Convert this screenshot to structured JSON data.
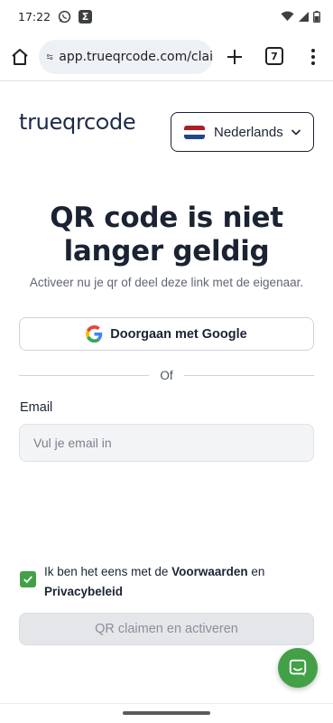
{
  "status_bar": {
    "time": "17:22",
    "icons": [
      "whatsapp-icon",
      "sigma-icon",
      "wifi-icon",
      "signal-icon",
      "battery-icon"
    ]
  },
  "browser": {
    "url": "app.trueqrcode.com/clai",
    "tab_count": "7"
  },
  "header": {
    "logo_text_before": "trueqrc",
    "logo_text_after": "de",
    "language": {
      "selected": "Nederlands",
      "flag_colors": [
        "#ae1c28",
        "#ffffff",
        "#21468b"
      ]
    }
  },
  "main": {
    "title_line1": "QR code is niet",
    "title_line2": "langer geldig",
    "subtitle": "Activeer nu je qr of deel deze link met de eigenaar.",
    "google_button": "Doorgaan met Google",
    "divider_text": "Of",
    "email_label": "Email",
    "email_placeholder": "Vul je email in",
    "email_value": "",
    "consent": {
      "checked": true,
      "prefix": "Ik ben het eens met de ",
      "terms_link": "Voorwaarden",
      "middle": " en",
      "privacy_link": "Privacybeleid"
    },
    "submit_button": "QR claimen en activeren"
  },
  "colors": {
    "accent_green": "#43a047",
    "text_dark": "#1b2333",
    "disabled_bg": "#e4e6ea"
  }
}
